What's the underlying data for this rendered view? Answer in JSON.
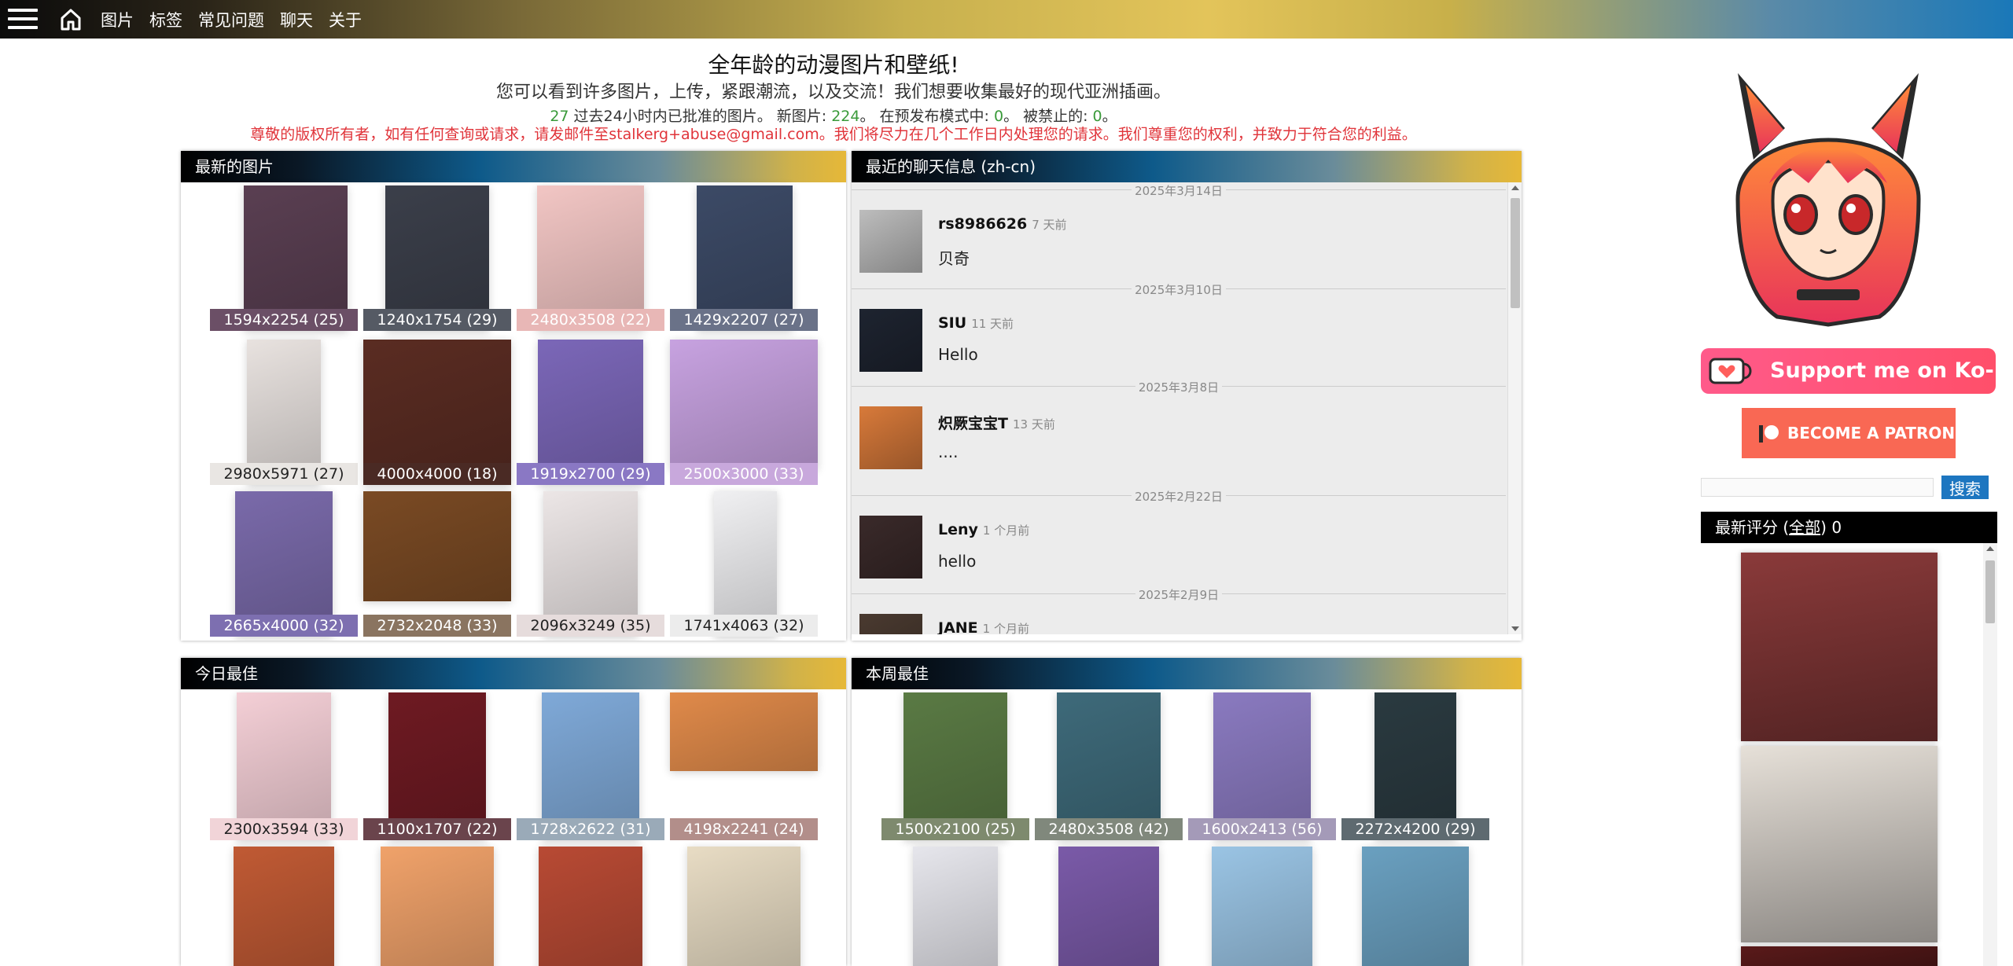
{
  "nav": {
    "items": [
      "图片",
      "标签",
      "常见问题",
      "聊天",
      "关于"
    ]
  },
  "header": {
    "title": "全年龄的动漫图片和壁纸!",
    "subtitle": "您可以看到许多图片，上传，紧跟潮流，以及交流！我们想要收集最好的现代亚洲插画。",
    "stats": {
      "approved_count": "27",
      "approved_label": " 过去24小时内已批准的图片。 新图片: ",
      "new_count": "224",
      "preview_label": "。 在预发布模式中: ",
      "preview_count": "0",
      "banned_label": "。 被禁止的: ",
      "banned_count": "0",
      "end": "。"
    },
    "notice": "尊敬的版权所有者，如有任何查询或请求，请发邮件至stalkerg+abuse@gmail.com。我们将尽力在几个工作日内处理您的请求。我们尊重您的权利，并致力于符合您的利益。"
  },
  "latest": {
    "title": "最新的图片",
    "thumbs": [
      {
        "caption": "1594x2254 (25)",
        "bg": "#5a3f52",
        "capbg": "#6b4f66"
      },
      {
        "caption": "1240x1754 (29)",
        "bg": "#3b3f4a",
        "capbg": "#555a64"
      },
      {
        "caption": "2480x3508 (22)",
        "bg": "#f2c6c4",
        "capbg": "#e8b7b6"
      },
      {
        "caption": "1429x2207 (27)",
        "bg": "#3c4a66",
        "capbg": "#6a7288"
      },
      {
        "caption": "2980x5971 (27)",
        "bg": "#e8e2df",
        "capbg": "#e9e6e3"
      },
      {
        "caption": "4000x4000 (18)",
        "bg": "#5a2c22",
        "capbg": "#4a2a24"
      },
      {
        "caption": "1919x2700 (29)",
        "bg": "#7b67b8",
        "capbg": "#8a78c4"
      },
      {
        "caption": "2500x3000 (33)",
        "bg": "#c7a2e0",
        "capbg": "#c8a8dc"
      },
      {
        "caption": "2665x4000 (32)",
        "bg": "#7a6aaa",
        "capbg": "#7d6fb0"
      },
      {
        "caption": "2732x2048 (33)",
        "bg": "#7a4a24",
        "capbg": "#8a7460"
      },
      {
        "caption": "2096x3249 (35)",
        "bg": "#ece6e6",
        "capbg": "#e6dcdc"
      },
      {
        "caption": "1741x4063 (32)",
        "bg": "#f0f0f2",
        "capbg": "#ececec"
      }
    ]
  },
  "chat": {
    "title": "最近的聊天信息 (zh-cn)",
    "entries": [
      {
        "date": "2025年3月14日",
        "user": "rs8986626",
        "ago": "7 天前",
        "text": "贝奇",
        "avatar": "#bdbdbd"
      },
      {
        "date": "2025年3月10日",
        "user": "SIU",
        "ago": "11 天前",
        "text": "Hello",
        "avatar": "#1e2430"
      },
      {
        "date": "2025年3月8日",
        "user": "炽厥宝宝T",
        "ago": "13 天前",
        "text": "....",
        "avatar": "#d87a3a"
      },
      {
        "date": "2025年2月22日",
        "user": "Leny",
        "ago": "1 个月前",
        "text": "hello",
        "avatar": "#3a2a2a"
      },
      {
        "date": "2025年2月9日",
        "user": "JANE",
        "ago": "1 个月前",
        "text": "",
        "avatar": "#4a3a30"
      }
    ]
  },
  "today": {
    "title": "今日最佳",
    "thumbs": [
      {
        "caption": "2300x3594 (33)",
        "bg": "#f4cfd6",
        "capbg": "#f1d4d8"
      },
      {
        "caption": "1100x1707 (22)",
        "bg": "#6e1a22",
        "capbg": "#6a444c"
      },
      {
        "caption": "1728x2622 (31)",
        "bg": "#7fa9d8",
        "capbg": "#9aaab8"
      },
      {
        "caption": "4198x2241 (24)",
        "bg": "#e08a4a",
        "capbg": "#b28e8a"
      },
      {
        "caption": "",
        "bg": "#c05a34",
        "capbg": "transparent"
      },
      {
        "caption": "",
        "bg": "#f0a26a",
        "capbg": "transparent"
      },
      {
        "caption": "",
        "bg": "#b84a34",
        "capbg": "transparent"
      },
      {
        "caption": "",
        "bg": "#e8dcc4",
        "capbg": "transparent"
      }
    ]
  },
  "week": {
    "title": "本周最佳",
    "thumbs": [
      {
        "caption": "1500x2100 (25)",
        "bg": "#5a7a44",
        "capbg": "#7e8a6e"
      },
      {
        "caption": "2480x3508 (42)",
        "bg": "#3e6a7a",
        "capbg": "#80887c"
      },
      {
        "caption": "1600x2413 (56)",
        "bg": "#8a7ac0",
        "capbg": "#a49ab8"
      },
      {
        "caption": "2272x4200 (29)",
        "bg": "#2a3a40",
        "capbg": "#5e6a70"
      },
      {
        "caption": "",
        "bg": "#e6e6ec",
        "capbg": "transparent"
      },
      {
        "caption": "",
        "bg": "#7a5aa8",
        "capbg": "transparent"
      },
      {
        "caption": "",
        "bg": "#9ac4e4",
        "capbg": "transparent"
      },
      {
        "caption": "",
        "bg": "#6aa0c0",
        "capbg": "transparent"
      }
    ]
  },
  "sidebar": {
    "kofi_label": "Support me on Ko-fi",
    "patron_label": "BECOME A PATRON",
    "search_button": "搜索",
    "search_placeholder": "",
    "ratings": {
      "title_prefix": "最新评分 (",
      "title_link": "全部",
      "title_suffix": ") 0",
      "cards": [
        {
          "bg": "#8a3a3a"
        },
        {
          "bg": "#e6e0d8"
        },
        {
          "bg": "#5a1a1a"
        }
      ]
    }
  }
}
